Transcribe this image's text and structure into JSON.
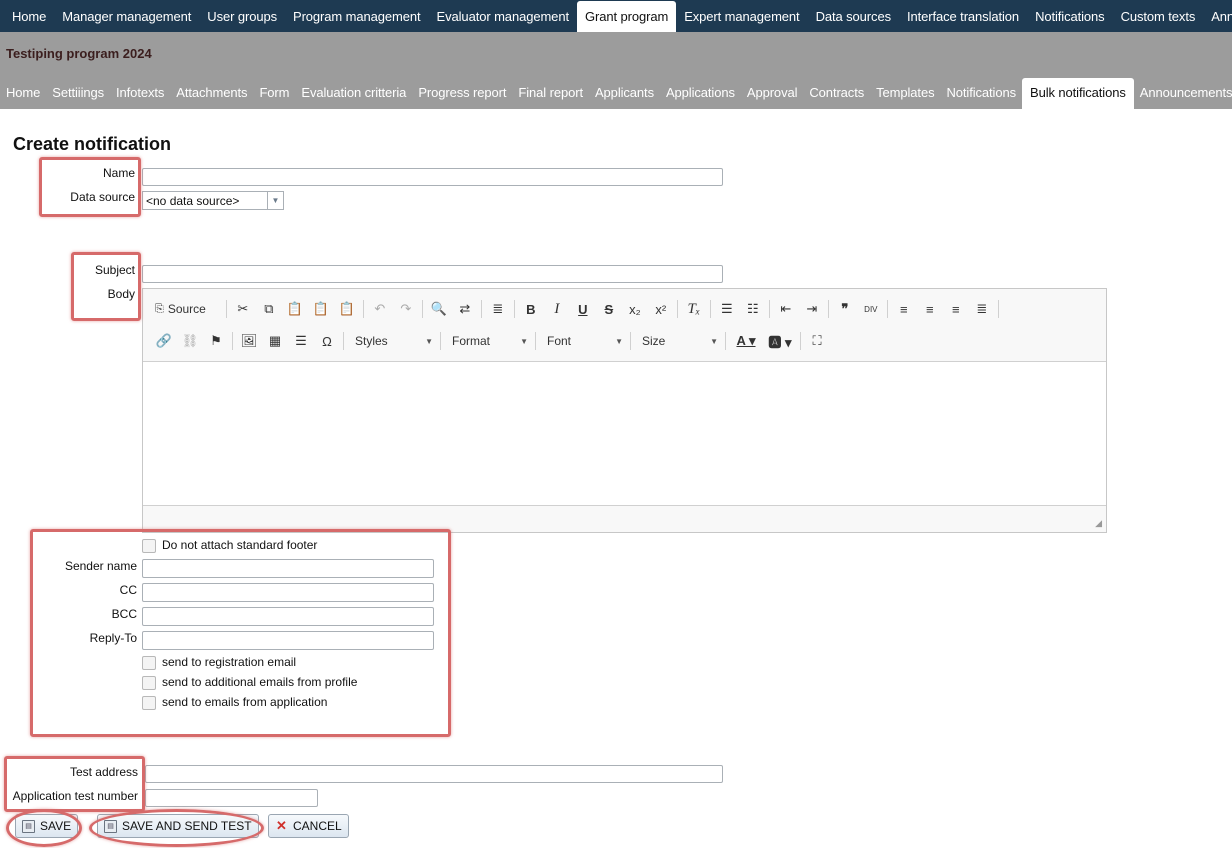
{
  "top_nav": {
    "items": [
      "Home",
      "Manager management",
      "User groups",
      "Program management",
      "Evaluator management",
      "Grant program",
      "Expert management",
      "Data sources",
      "Interface translation",
      "Notifications",
      "Custom texts",
      "Announcements"
    ],
    "active": "Grant program"
  },
  "program": {
    "title": "Testiping program 2024"
  },
  "sub_nav": {
    "items": [
      "Home",
      "Settiiings",
      "Infotexts",
      "Attachments",
      "Form",
      "Evaluation critteria",
      "Progress report",
      "Final report",
      "Applicants",
      "Applications",
      "Approval",
      "Contracts",
      "Templates",
      "Notifications",
      "Bulk notifications",
      "Announcements"
    ],
    "active": "Bulk notifications"
  },
  "form": {
    "heading": "Create notification",
    "name_label": "Name",
    "name_value": "",
    "data_source_label": "Data source",
    "data_source_value": "<no data source>",
    "subject_label": "Subject",
    "subject_value": "",
    "body_label": "Body",
    "footer_checkbox_label": "Do not attach standard footer",
    "sender_name_label": "Sender name",
    "cc_label": "CC",
    "bcc_label": "BCC",
    "reply_to_label": "Reply-To",
    "send_registration_label": "send to registration email",
    "send_additional_label": "send to additional emails from profile",
    "send_application_label": "send to emails from application",
    "test_address_label": "Test address",
    "app_test_number_label": "Application test number"
  },
  "editor": {
    "source_label": "Source",
    "styles_label": "Styles",
    "format_label": "Format",
    "font_label": "Font",
    "size_label": "Size"
  },
  "buttons": {
    "save": "SAVE",
    "save_and_send_test": "SAVE AND SEND TEST",
    "cancel": "CANCEL"
  },
  "colors": {
    "top_nav_bg": "#1e3a52",
    "banner_bg": "#9c9c9c",
    "highlight": "#d66a6a"
  }
}
